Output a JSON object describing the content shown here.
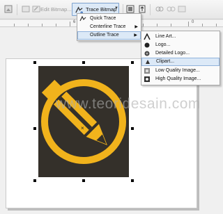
{
  "toolbar": {
    "edit_bitmap_label": "Edit Bitmap...",
    "trace_bitmap_label": "Trace Bitmap"
  },
  "ruler": {
    "marks": [
      "",
      "6",
      "2",
      "0"
    ]
  },
  "trace_menu": {
    "items": [
      {
        "label": "Quick Trace",
        "icon": "quick-trace-icon"
      },
      {
        "label": "Centerline Trace",
        "icon": "",
        "has_submenu": true
      },
      {
        "label": "Outline Trace",
        "icon": "",
        "has_submenu": true,
        "highlighted": true
      }
    ]
  },
  "outline_menu": {
    "items": [
      {
        "label": "Line Art...",
        "icon": "line-art-icon"
      },
      {
        "label": "Logo...",
        "icon": "logo-icon"
      },
      {
        "label": "Detailed Logo...",
        "icon": "detailed-logo-icon"
      },
      {
        "label": "Clipart...",
        "icon": "clipart-icon",
        "highlighted": true
      },
      {
        "label": "Low Quality Image...",
        "icon": "low-quality-image-icon"
      },
      {
        "label": "High Quality Image...",
        "icon": "high-quality-image-icon"
      }
    ]
  },
  "canvas": {
    "watermark": "www.teoridesain.com"
  },
  "colors": {
    "logo_yellow": "#f1b31c",
    "logo_background": "#34302a",
    "highlight": "#dce9f7"
  }
}
